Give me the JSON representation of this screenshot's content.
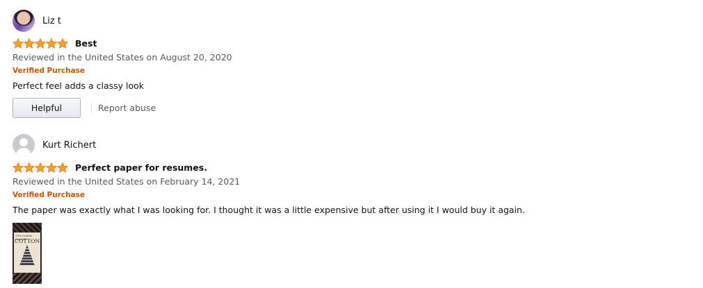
{
  "colors": {
    "star": "#FFA41C",
    "star_outline": "#DE7921",
    "verified": "#C45500",
    "secondary_text": "#565959"
  },
  "reviews": [
    {
      "name": "Liz t",
      "avatar": "user-photo",
      "rating": 5,
      "title": "Best",
      "date": "Reviewed in the United States on August 20, 2020",
      "verified": "Verified Purchase",
      "body": "Perfect feel adds a classy look",
      "helpful_label": "Helpful",
      "report_label": "Report abuse"
    },
    {
      "name": "Kurt Richert",
      "avatar": "default-avatar-icon",
      "rating": 5,
      "title": "Perfect paper for resumes.",
      "date": "Reviewed in the United States on February 14, 2021",
      "verified": "Verified Purchase",
      "body": "The paper was exactly what I was looking for. I thought it was a little expensive but after using it I would buy it again.",
      "image": {
        "line1": "75% Cotton content",
        "line2": "COTTON"
      }
    }
  ]
}
